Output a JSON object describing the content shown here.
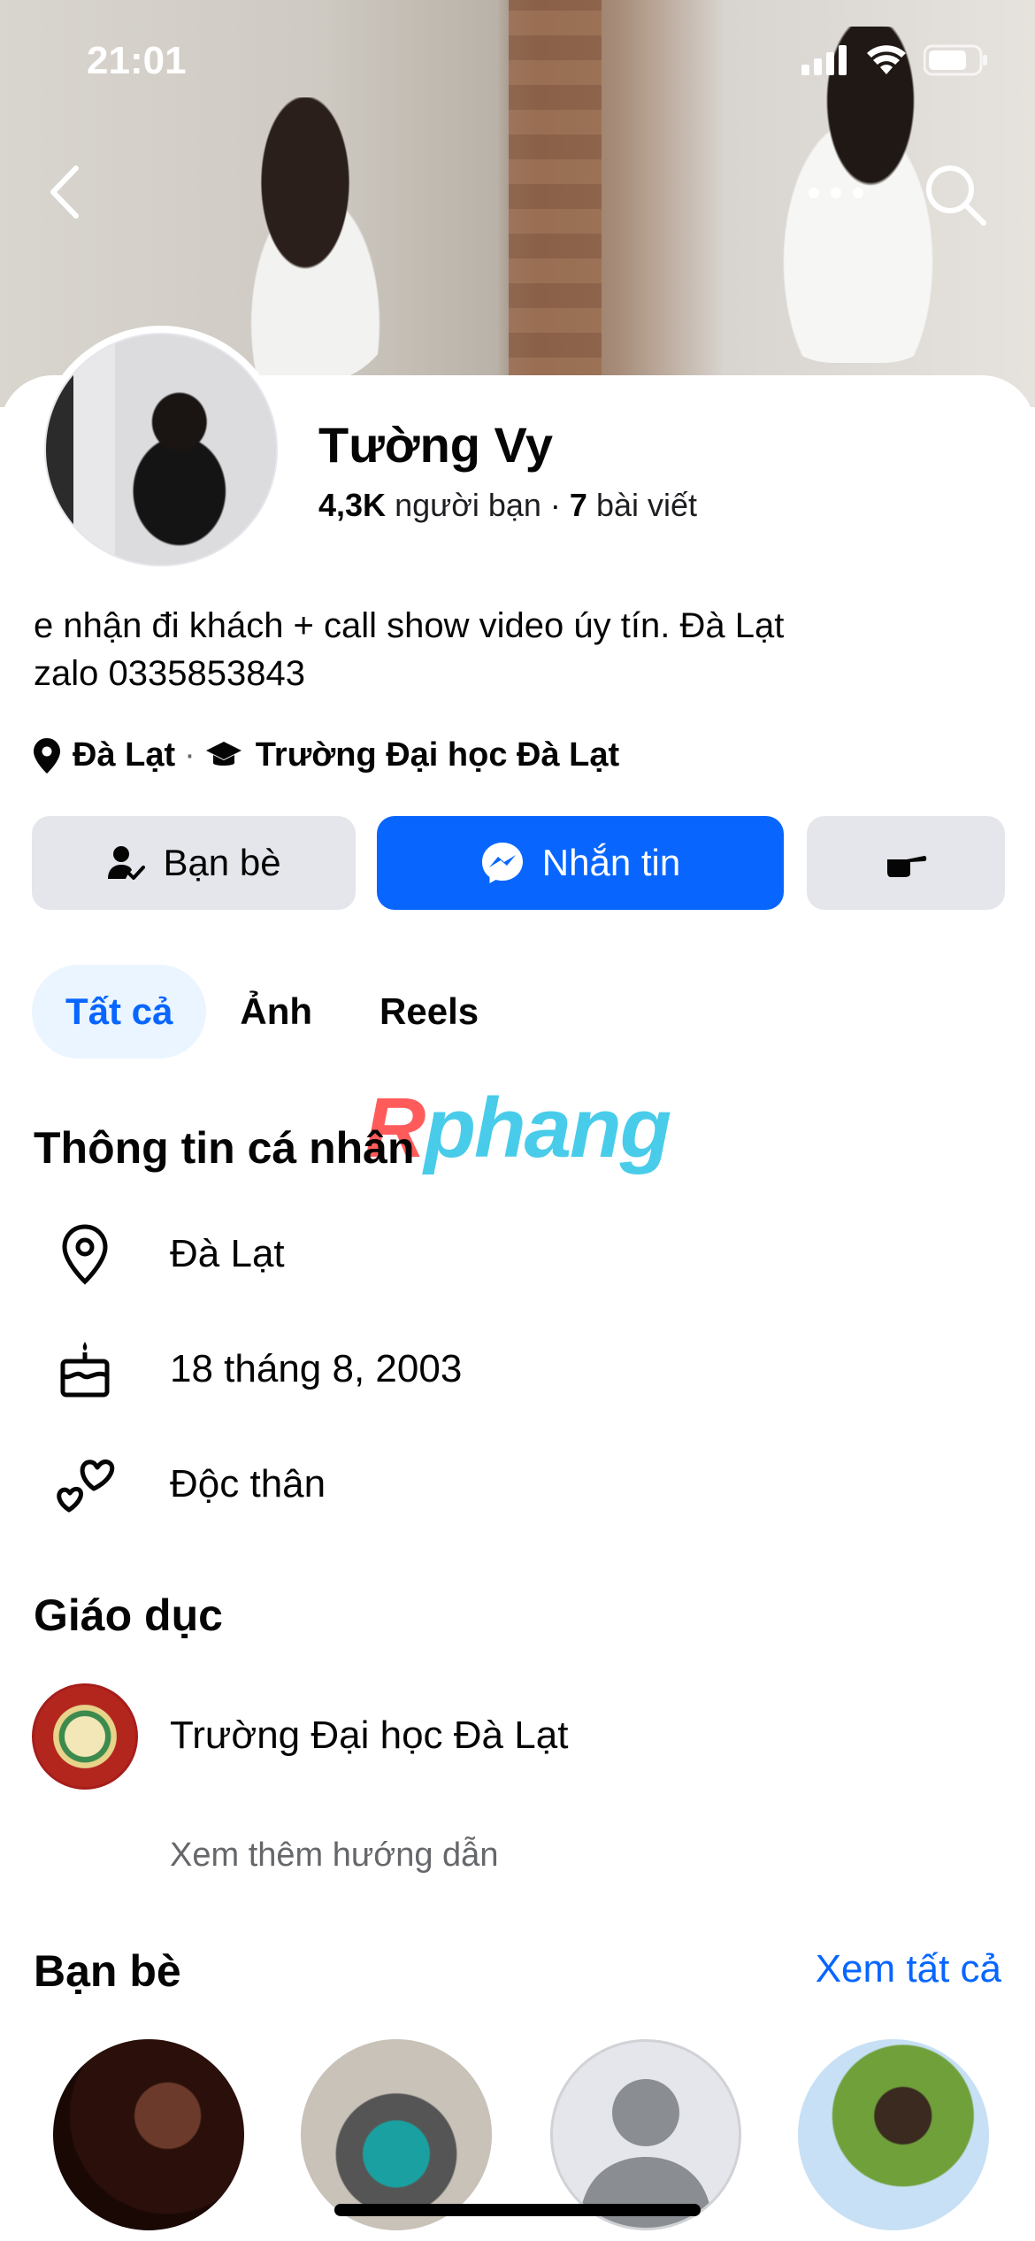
{
  "status": {
    "time": "21:01"
  },
  "profile": {
    "name": "Tường Vy",
    "friends_count": "4,3K",
    "friends_label": "người bạn",
    "dot": "·",
    "posts_count": "7",
    "posts_label": "bài viết",
    "bio": "e nhận đi khách + call show video úy tín. Đà Lạt\nzalo 0335853843",
    "location": "Đà Lạt",
    "meta_sep": "·",
    "school": "Trường Đại học Đà Lạt"
  },
  "actions": {
    "friends_label": "Bạn bè",
    "message_label": "Nhắn tin"
  },
  "tabs": [
    {
      "label": "Tất cả",
      "active": true
    },
    {
      "label": "Ảnh",
      "active": false
    },
    {
      "label": "Reels",
      "active": false
    }
  ],
  "watermark": {
    "r": "R",
    "rest": "phang"
  },
  "personal_info": {
    "title": "Thông tin cá nhân",
    "location": "Đà Lạt",
    "birthday": "18 tháng 8, 2003",
    "relationship": "Độc thân"
  },
  "education": {
    "title": "Giáo dục",
    "school": "Trường Đại học Đà Lạt",
    "see_more": "Xem thêm hướng dẫn"
  },
  "friends_section": {
    "title": "Bạn bè",
    "see_all": "Xem tất cả"
  },
  "colors": {
    "accent": "#0866ff",
    "button_gray": "#e4e6eb",
    "tab_active_bg": "#ebf5ff",
    "muted_text": "#65676b"
  },
  "icons": [
    "back-icon",
    "more-icon",
    "search-icon",
    "location-pin-icon",
    "graduation-cap-icon",
    "friend-check-icon",
    "messenger-icon",
    "poke-icon",
    "birthday-cake-icon",
    "hearts-icon"
  ]
}
